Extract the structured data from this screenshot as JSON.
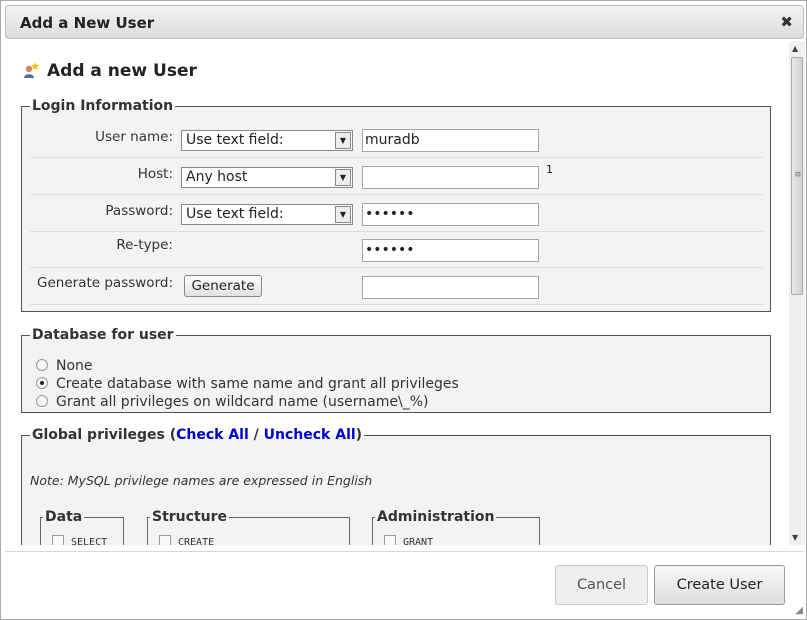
{
  "dialog": {
    "title": "Add a New User",
    "close_icon": "close-icon"
  },
  "heading": {
    "text": "Add a new User",
    "icon": "add-user-icon"
  },
  "login": {
    "legend": "Login Information",
    "username": {
      "label": "User name:",
      "select": "Use text field:",
      "value": "muradb"
    },
    "host": {
      "label": "Host:",
      "select": "Any host",
      "value": "",
      "footnote": "1"
    },
    "password": {
      "label": "Password:",
      "select": "Use text field:",
      "value": "••••••"
    },
    "retype": {
      "label": "Re-type:",
      "value": "••••••"
    },
    "generate": {
      "label": "Generate password:",
      "button": "Generate",
      "value": ""
    }
  },
  "database": {
    "legend": "Database for user",
    "options": [
      {
        "label": "None",
        "checked": false
      },
      {
        "label": "Create database with same name and grant all privileges",
        "checked": true
      },
      {
        "label": "Grant all privileges on wildcard name (username\\_%)",
        "checked": false
      }
    ]
  },
  "privileges": {
    "legend_prefix": "Global privileges (",
    "check_all": "Check All",
    "separator": " / ",
    "uncheck_all": "Uncheck All",
    "legend_suffix": ")",
    "note": "Note: MySQL privilege names are expressed in English",
    "groups": [
      {
        "legend": "Data",
        "first_item": "SELECT"
      },
      {
        "legend": "Structure",
        "first_item": "CREATE"
      },
      {
        "legend": "Administration",
        "first_item": "GRANT"
      }
    ]
  },
  "buttons": {
    "cancel": "Cancel",
    "create": "Create User"
  }
}
